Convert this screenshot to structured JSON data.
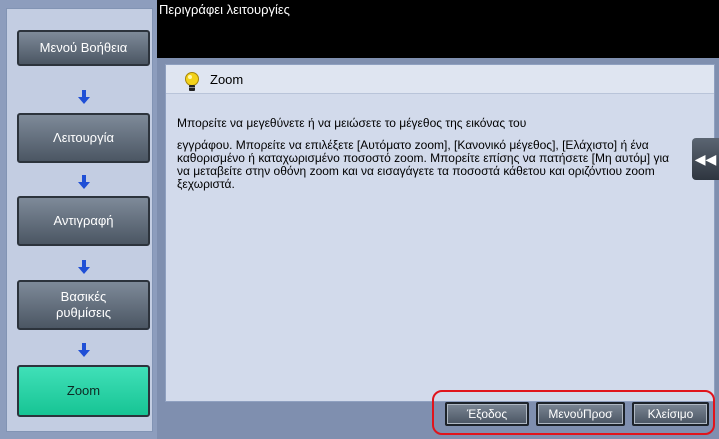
{
  "sidebar": {
    "items": [
      {
        "label": "Μενού Βοήθεια"
      },
      {
        "label": "Λειτουργία"
      },
      {
        "label": "Αντιγραφή"
      },
      {
        "label": "Βασικές ρυθμίσεις"
      },
      {
        "label": "Zoom"
      }
    ],
    "active_color": "#1ec89b"
  },
  "header": {
    "title": "Περιγράφει λειτουργίες"
  },
  "card": {
    "title": "Zoom",
    "paragraph1": "Μπορείτε να μεγεθύνετε ή να μειώσετε το μέγεθος της εικόνας του",
    "paragraph2": "εγγράφου. Μπορείτε να επιλέξετε [Αυτόματο zoom], [Κανονικό μέγεθος], [Ελάχιστο] ή ένα καθορισμένο ή καταχωρισμένο ποσοστό zoom. Μπορείτε επίσης να πατήσετε [Μη αυτόμ] για να μεταβείτε στην οθόνη zoom και να εισαγάγετε τα ποσοστά κάθετου και οριζόντιου zoom ξεχωριστά."
  },
  "side_tab": {
    "icon": "double-chevron-left-icon",
    "glyph": "◀◀"
  },
  "footer": {
    "exit_label": "Έξοδος",
    "prev_menu_label": "ΜενούΠροσ",
    "close_label": "Κλείσιμο",
    "highlight_color": "#e0141c"
  }
}
